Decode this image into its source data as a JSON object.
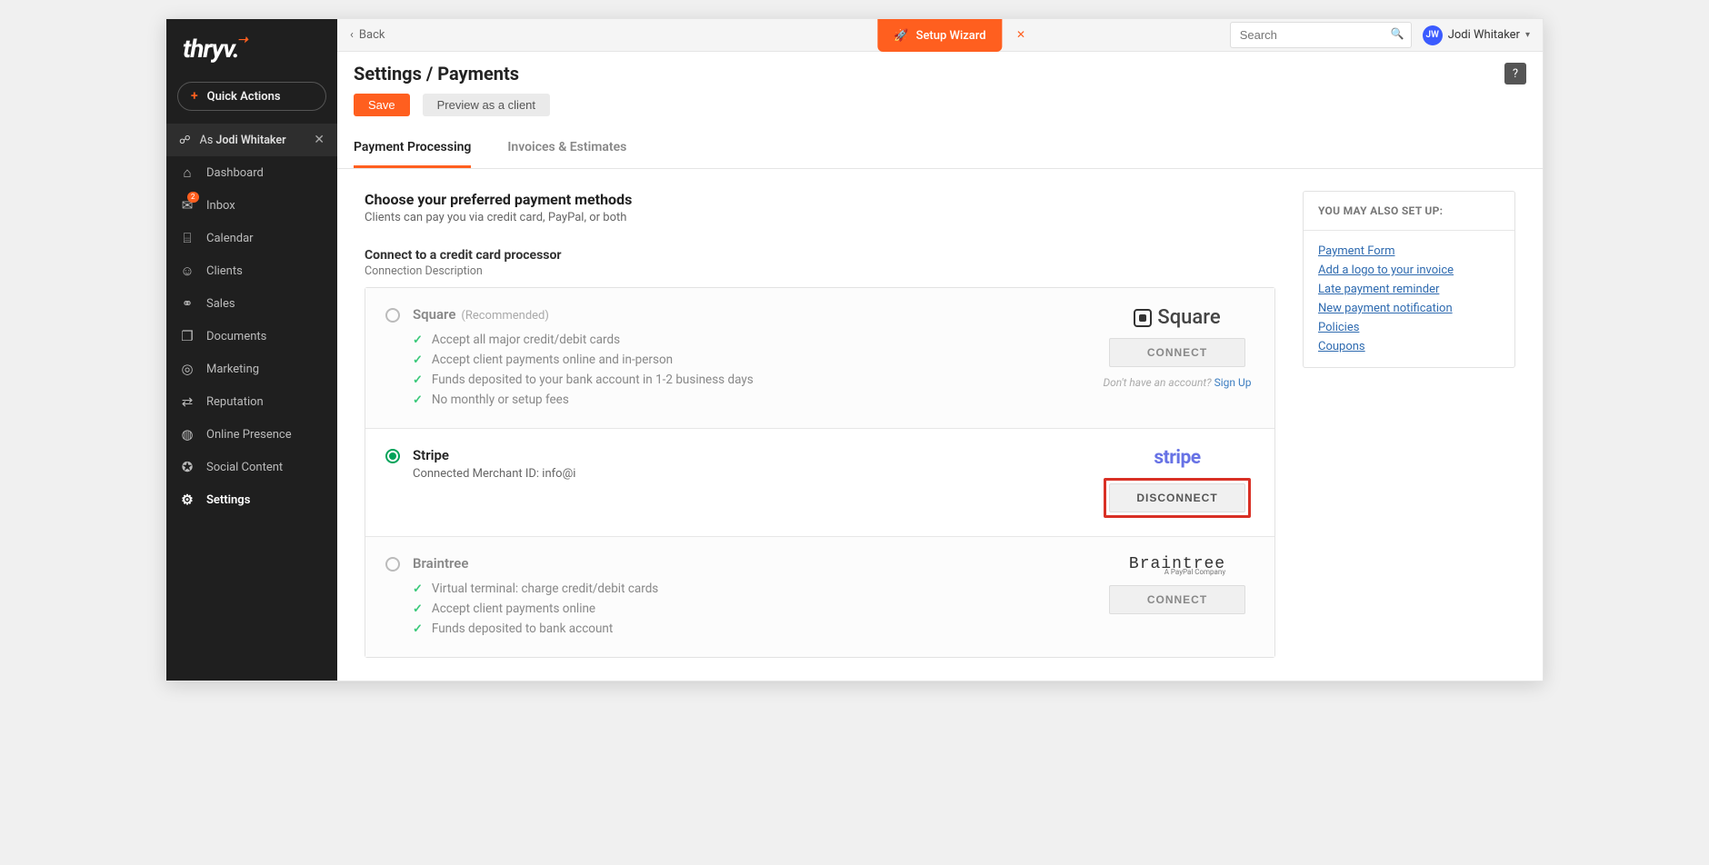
{
  "logo": "thryv",
  "quickActions": "Quick Actions",
  "impersonate": {
    "prefix": "As",
    "name": "Jodi Whitaker"
  },
  "nav": [
    {
      "id": "dashboard",
      "label": "Dashboard",
      "icon": "⌂",
      "active": false,
      "badge": null
    },
    {
      "id": "inbox",
      "label": "Inbox",
      "icon": "✉",
      "active": false,
      "badge": "2"
    },
    {
      "id": "calendar",
      "label": "Calendar",
      "icon": "⌸",
      "active": false,
      "badge": null
    },
    {
      "id": "clients",
      "label": "Clients",
      "icon": "☺",
      "active": false,
      "badge": null
    },
    {
      "id": "sales",
      "label": "Sales",
      "icon": "⚭",
      "active": false,
      "badge": null
    },
    {
      "id": "documents",
      "label": "Documents",
      "icon": "❐",
      "active": false,
      "badge": null
    },
    {
      "id": "marketing",
      "label": "Marketing",
      "icon": "◎",
      "active": false,
      "badge": null
    },
    {
      "id": "reputation",
      "label": "Reputation",
      "icon": "⇄",
      "active": false,
      "badge": null
    },
    {
      "id": "online-presence",
      "label": "Online Presence",
      "icon": "◍",
      "active": false,
      "badge": null
    },
    {
      "id": "social-content",
      "label": "Social Content",
      "icon": "✪",
      "active": false,
      "badge": null
    },
    {
      "id": "settings",
      "label": "Settings",
      "icon": "⚙",
      "active": true,
      "badge": null
    }
  ],
  "back": "Back",
  "wizard": "Setup Wizard",
  "searchPlaceholder": "Search",
  "user": {
    "initials": "JW",
    "name": "Jodi Whitaker"
  },
  "pageTitle": "Settings / Payments",
  "saveBtn": "Save",
  "previewBtn": "Preview as a client",
  "tabs": {
    "processing": "Payment Processing",
    "invoices": "Invoices & Estimates"
  },
  "section": {
    "title": "Choose your preferred payment methods",
    "sub": "Clients can pay you via credit card, PayPal, or both",
    "connectTitle": "Connect to a credit card processor",
    "connectSub": "Connection Description"
  },
  "connectLabel": "CONNECT",
  "disconnectLabel": "DISCONNECT",
  "signup": {
    "prefix": "Don't have an account? ",
    "link": "Sign Up"
  },
  "processors": {
    "square": {
      "name": "Square",
      "reco": "(Recommended)",
      "logoText": "Square",
      "features": [
        "Accept all major credit/debit cards",
        "Accept client payments online and in-person",
        "Funds deposited to your bank account in 1-2 business days",
        "No monthly or setup fees"
      ]
    },
    "stripe": {
      "name": "Stripe",
      "merchantLine": "Connected Merchant ID: info@i",
      "logoText": "stripe"
    },
    "braintree": {
      "name": "Braintree",
      "logoText": "Braintree",
      "logoSub": "A PayPal Company",
      "features": [
        "Virtual terminal: charge credit/debit cards",
        "Accept client payments online",
        "Funds deposited to bank account"
      ]
    }
  },
  "rightCol": {
    "header": "YOU MAY ALSO SET UP:",
    "links": [
      "Payment Form",
      "Add a logo to your invoice",
      "Late payment reminder",
      "New payment notification",
      "Policies",
      "Coupons"
    ]
  }
}
